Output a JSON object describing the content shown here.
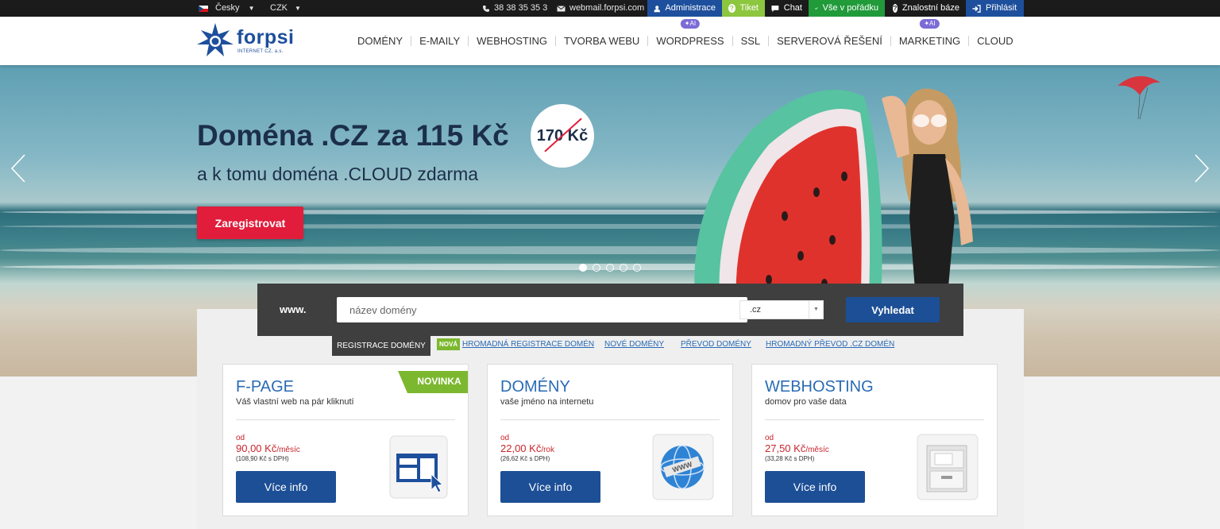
{
  "topbar": {
    "language": "Česky",
    "currency": "CZK",
    "phone": "38 38 35 35 3",
    "webmail": "webmail.forpsi.com",
    "administrace": "Administrace",
    "tiket": "Tiket",
    "chat": "Chat",
    "status": "Vše v pořádku",
    "knowledge": "Znalostní báze",
    "login": "Přihlásit",
    "colors": {
      "administrace": "#1d4f9c",
      "tiket": "#8dc63f",
      "status": "#219a3a",
      "login": "#1d4f9c"
    }
  },
  "logo": {
    "name": "forpsi",
    "subtitle": "INTERNET CZ, a.s."
  },
  "nav": {
    "items": [
      {
        "label": "DOMÉNY"
      },
      {
        "label": "E-MAILY"
      },
      {
        "label": "WEBHOSTING"
      },
      {
        "label": "TVORBA WEBU"
      },
      {
        "label": "WORDPRESS",
        "badge": "AI"
      },
      {
        "label": "SSL"
      },
      {
        "label": "SERVEROVÁ ŘEŠENÍ"
      },
      {
        "label": "MARKETING",
        "badge": "AI"
      },
      {
        "label": "CLOUD"
      }
    ]
  },
  "hero": {
    "title": "Doména .CZ za 115 Kč",
    "subtitle": "a k tomu doména .CLOUD zdarma",
    "old_price": "170 Kč",
    "cta": "Zaregistrovat",
    "slides_count": 5,
    "active_slide": 1
  },
  "search": {
    "prefix": "www.",
    "placeholder": "název domény",
    "tld": ".cz",
    "button": "Vyhledat"
  },
  "subnav": {
    "active_tab": "REGISTRACE DOMÉNY",
    "badge": "NOVÁ",
    "links": [
      "HROMADNÁ REGISTRACE DOMÉN",
      "NOVÉ DOMÉNY",
      "PŘEVOD DOMÉNY",
      "HROMADNÝ PŘEVOD .CZ DOMÉN"
    ]
  },
  "cards": [
    {
      "title": "F-PAGE",
      "subtitle": "Váš vlastní web na pár kliknutí",
      "from": "od",
      "price": "90,00 Kč",
      "unit": "/měsíc",
      "price_dph": "(108,90 Kč s DPH)",
      "button": "Více info",
      "ribbon": "NOVINKA",
      "icon": "web-builder-icon"
    },
    {
      "title": "DOMÉNY",
      "subtitle": "vaše jméno na internetu",
      "from": "od",
      "price": "22,00 Kč",
      "unit": "/rok",
      "price_dph": "(26,62 Kč s DPH)",
      "button": "Více info",
      "icon": "globe-www-icon",
      "globe_label": "WWW"
    },
    {
      "title": "WEBHOSTING",
      "subtitle": "domov pro vaše data",
      "from": "od",
      "price": "27,50 Kč",
      "unit": "/měsíc",
      "price_dph": "(33,28 Kč s DPH)",
      "button": "Více info",
      "icon": "server-drawer-icon"
    }
  ]
}
